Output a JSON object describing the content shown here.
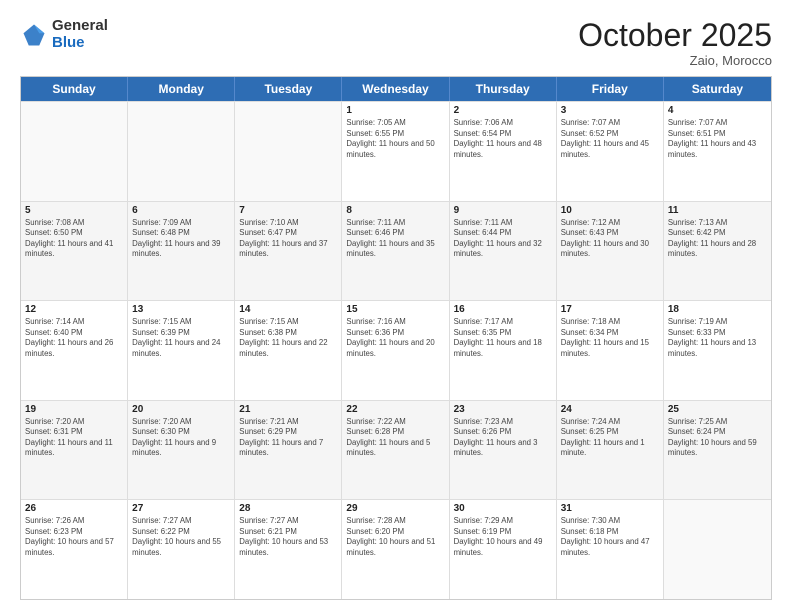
{
  "logo": {
    "general": "General",
    "blue": "Blue"
  },
  "title": "October 2025",
  "subtitle": "Zaio, Morocco",
  "days": [
    "Sunday",
    "Monday",
    "Tuesday",
    "Wednesday",
    "Thursday",
    "Friday",
    "Saturday"
  ],
  "weeks": [
    [
      {
        "num": "",
        "info": ""
      },
      {
        "num": "",
        "info": ""
      },
      {
        "num": "",
        "info": ""
      },
      {
        "num": "1",
        "info": "Sunrise: 7:05 AM\nSunset: 6:55 PM\nDaylight: 11 hours and 50 minutes."
      },
      {
        "num": "2",
        "info": "Sunrise: 7:06 AM\nSunset: 6:54 PM\nDaylight: 11 hours and 48 minutes."
      },
      {
        "num": "3",
        "info": "Sunrise: 7:07 AM\nSunset: 6:52 PM\nDaylight: 11 hours and 45 minutes."
      },
      {
        "num": "4",
        "info": "Sunrise: 7:07 AM\nSunset: 6:51 PM\nDaylight: 11 hours and 43 minutes."
      }
    ],
    [
      {
        "num": "5",
        "info": "Sunrise: 7:08 AM\nSunset: 6:50 PM\nDaylight: 11 hours and 41 minutes."
      },
      {
        "num": "6",
        "info": "Sunrise: 7:09 AM\nSunset: 6:48 PM\nDaylight: 11 hours and 39 minutes."
      },
      {
        "num": "7",
        "info": "Sunrise: 7:10 AM\nSunset: 6:47 PM\nDaylight: 11 hours and 37 minutes."
      },
      {
        "num": "8",
        "info": "Sunrise: 7:11 AM\nSunset: 6:46 PM\nDaylight: 11 hours and 35 minutes."
      },
      {
        "num": "9",
        "info": "Sunrise: 7:11 AM\nSunset: 6:44 PM\nDaylight: 11 hours and 32 minutes."
      },
      {
        "num": "10",
        "info": "Sunrise: 7:12 AM\nSunset: 6:43 PM\nDaylight: 11 hours and 30 minutes."
      },
      {
        "num": "11",
        "info": "Sunrise: 7:13 AM\nSunset: 6:42 PM\nDaylight: 11 hours and 28 minutes."
      }
    ],
    [
      {
        "num": "12",
        "info": "Sunrise: 7:14 AM\nSunset: 6:40 PM\nDaylight: 11 hours and 26 minutes."
      },
      {
        "num": "13",
        "info": "Sunrise: 7:15 AM\nSunset: 6:39 PM\nDaylight: 11 hours and 24 minutes."
      },
      {
        "num": "14",
        "info": "Sunrise: 7:15 AM\nSunset: 6:38 PM\nDaylight: 11 hours and 22 minutes."
      },
      {
        "num": "15",
        "info": "Sunrise: 7:16 AM\nSunset: 6:36 PM\nDaylight: 11 hours and 20 minutes."
      },
      {
        "num": "16",
        "info": "Sunrise: 7:17 AM\nSunset: 6:35 PM\nDaylight: 11 hours and 18 minutes."
      },
      {
        "num": "17",
        "info": "Sunrise: 7:18 AM\nSunset: 6:34 PM\nDaylight: 11 hours and 15 minutes."
      },
      {
        "num": "18",
        "info": "Sunrise: 7:19 AM\nSunset: 6:33 PM\nDaylight: 11 hours and 13 minutes."
      }
    ],
    [
      {
        "num": "19",
        "info": "Sunrise: 7:20 AM\nSunset: 6:31 PM\nDaylight: 11 hours and 11 minutes."
      },
      {
        "num": "20",
        "info": "Sunrise: 7:20 AM\nSunset: 6:30 PM\nDaylight: 11 hours and 9 minutes."
      },
      {
        "num": "21",
        "info": "Sunrise: 7:21 AM\nSunset: 6:29 PM\nDaylight: 11 hours and 7 minutes."
      },
      {
        "num": "22",
        "info": "Sunrise: 7:22 AM\nSunset: 6:28 PM\nDaylight: 11 hours and 5 minutes."
      },
      {
        "num": "23",
        "info": "Sunrise: 7:23 AM\nSunset: 6:26 PM\nDaylight: 11 hours and 3 minutes."
      },
      {
        "num": "24",
        "info": "Sunrise: 7:24 AM\nSunset: 6:25 PM\nDaylight: 11 hours and 1 minute."
      },
      {
        "num": "25",
        "info": "Sunrise: 7:25 AM\nSunset: 6:24 PM\nDaylight: 10 hours and 59 minutes."
      }
    ],
    [
      {
        "num": "26",
        "info": "Sunrise: 7:26 AM\nSunset: 6:23 PM\nDaylight: 10 hours and 57 minutes."
      },
      {
        "num": "27",
        "info": "Sunrise: 7:27 AM\nSunset: 6:22 PM\nDaylight: 10 hours and 55 minutes."
      },
      {
        "num": "28",
        "info": "Sunrise: 7:27 AM\nSunset: 6:21 PM\nDaylight: 10 hours and 53 minutes."
      },
      {
        "num": "29",
        "info": "Sunrise: 7:28 AM\nSunset: 6:20 PM\nDaylight: 10 hours and 51 minutes."
      },
      {
        "num": "30",
        "info": "Sunrise: 7:29 AM\nSunset: 6:19 PM\nDaylight: 10 hours and 49 minutes."
      },
      {
        "num": "31",
        "info": "Sunrise: 7:30 AM\nSunset: 6:18 PM\nDaylight: 10 hours and 47 minutes."
      },
      {
        "num": "",
        "info": ""
      }
    ]
  ]
}
